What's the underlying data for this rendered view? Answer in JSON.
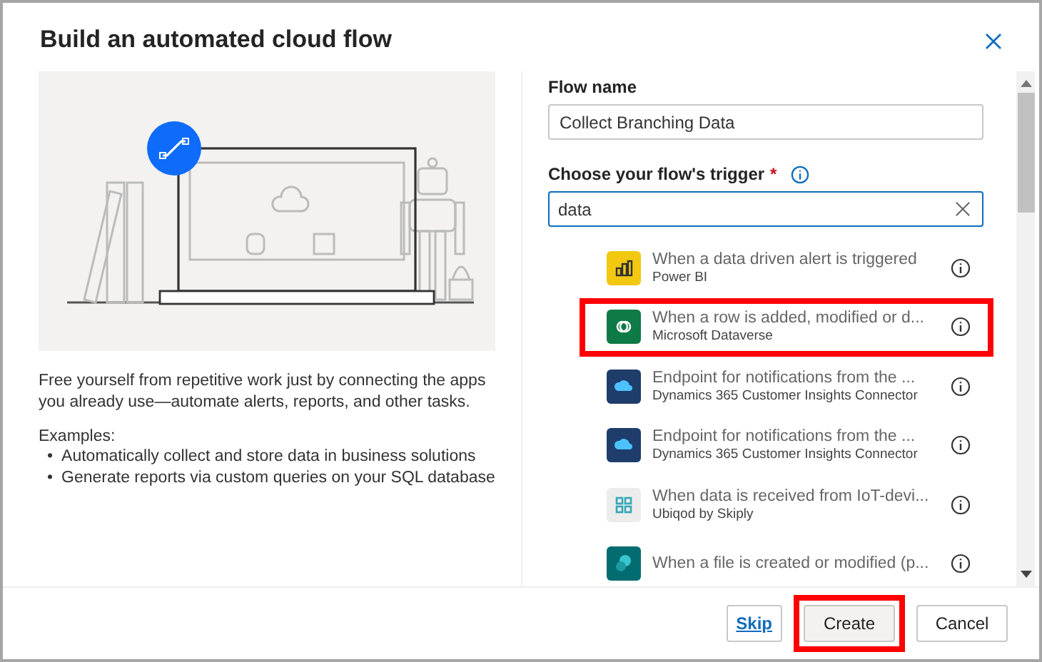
{
  "dialog": {
    "title": "Build an automated cloud flow"
  },
  "description": {
    "text": "Free yourself from repetitive work just by connecting the apps you already use—automate alerts, reports, and other tasks.",
    "examples_label": "Examples:",
    "examples": [
      {
        "marker": "•",
        "text": "Automatically collect and store data in business solutions"
      },
      {
        "marker": "•",
        "text": "Generate reports via custom queries on your SQL database"
      }
    ]
  },
  "flow_name": {
    "label": "Flow name",
    "value": "Collect Branching Data"
  },
  "trigger": {
    "label": "Choose your flow's trigger",
    "required_mark": "*",
    "search_value": "data",
    "items": [
      {
        "title": "When a data driven alert is triggered",
        "connector": "Power BI",
        "color": "#f2c811",
        "kind": "chart",
        "highlighted": false
      },
      {
        "title": "When a row is added, modified or d...",
        "connector": "Microsoft Dataverse",
        "color": "#0e7a45",
        "kind": "rings",
        "highlighted": true
      },
      {
        "title": "Endpoint for notifications from the ...",
        "connector": "Dynamics 365 Customer Insights Connector",
        "color": "#1f3d6b",
        "kind": "cloud",
        "highlighted": false
      },
      {
        "title": "Endpoint for notifications from the ...",
        "connector": "Dynamics 365 Customer Insights Connector",
        "color": "#1f3d6b",
        "kind": "cloud",
        "highlighted": false
      },
      {
        "title": "When data is received from IoT-devi...",
        "connector": "Ubiqod by Skiply",
        "color": "#ececec",
        "kind": "grid",
        "highlighted": false
      },
      {
        "title": "When a file is created or modified (p...",
        "color": "#036c70",
        "kind": "share",
        "highlighted": false
      }
    ]
  },
  "buttons": [
    {
      "label": "Skip",
      "kind": "link",
      "highlighted": false
    },
    {
      "label": "Create",
      "kind": "primary",
      "highlighted": true
    },
    {
      "label": "Cancel",
      "kind": "default",
      "highlighted": false
    }
  ]
}
